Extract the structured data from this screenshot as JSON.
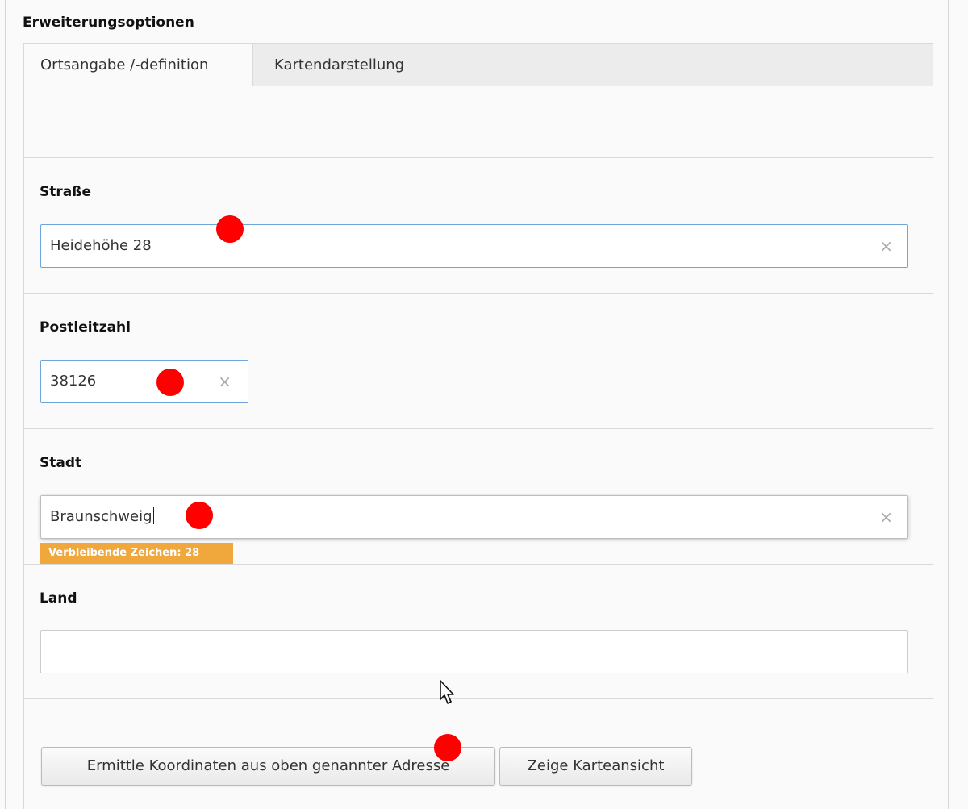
{
  "section": {
    "title": "Erweiterungsoptionen"
  },
  "tabs": [
    {
      "label": "Ortsangabe /-definition",
      "active": true
    },
    {
      "label": "Kartendarstellung",
      "active": false
    }
  ],
  "fields": {
    "strasse": {
      "label": "Straße",
      "value": "Heidehöhe 28",
      "clear_icon": "×"
    },
    "plz": {
      "label": "Postleitzahl",
      "value": "38126",
      "clear_icon": "×"
    },
    "stadt": {
      "label": "Stadt",
      "value": "Braunschweig",
      "clear_icon": "×",
      "remaining_chars": "Verbleibende Zeichen: 28"
    },
    "land": {
      "label": "Land",
      "value": ""
    }
  },
  "buttons": {
    "geocode": "Ermittle Koordinaten aus oben genannter Adresse",
    "show_map": "Zeige Karteansicht"
  },
  "colors": {
    "accent_border": "#6fa5dc",
    "badge": "#f0a83c",
    "marker": "#ff0000"
  },
  "icons": {
    "clear": "close-icon",
    "pointer": "mouse-cursor-icon",
    "marker": "red-dot-marker"
  }
}
